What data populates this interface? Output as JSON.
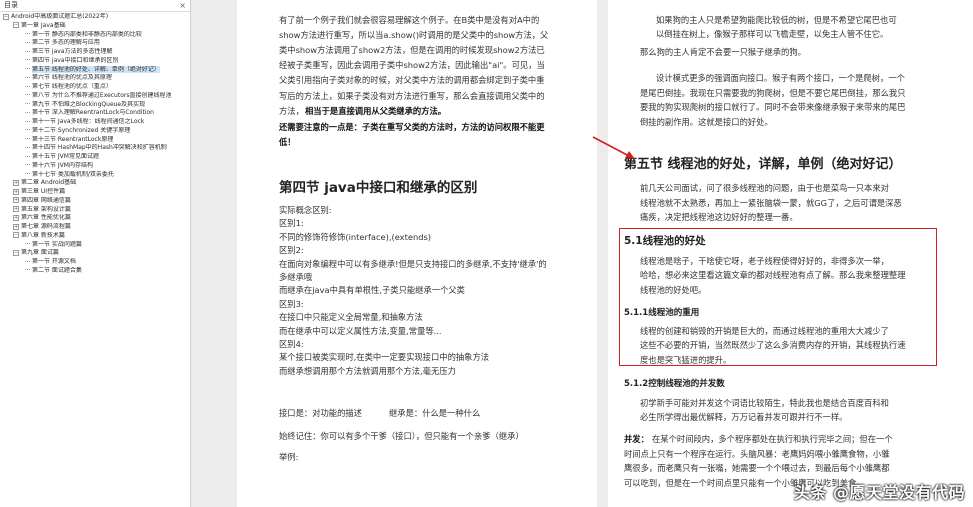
{
  "sidebar": {
    "title": "目录",
    "close_glyph": "×",
    "items": [
      {
        "lv": 0,
        "exp": "−",
        "label": "Android中高级面试题汇总(2022年)"
      },
      {
        "lv": 1,
        "exp": "−",
        "label": "第一章 Java基础"
      },
      {
        "lv": 2,
        "exp": "",
        "label": "第一节 静态内部类和非静态内部类的比较"
      },
      {
        "lv": 2,
        "exp": "",
        "label": "第二节 多态的理解与应用"
      },
      {
        "lv": 2,
        "exp": "",
        "label": "第三节 java方法的多态性理解"
      },
      {
        "lv": 2,
        "exp": "",
        "label": "第四节 java中接口和继承的区别"
      },
      {
        "lv": 2,
        "exp": "",
        "label": "第五节 线程池的好处、详解、单例（绝对好记）",
        "sel": true
      },
      {
        "lv": 2,
        "exp": "",
        "label": "第六节 线程池的优点及其原理"
      },
      {
        "lv": 2,
        "exp": "",
        "label": "第七节 线程池的优点（重点）"
      },
      {
        "lv": 2,
        "exp": "",
        "label": "第八节 为什么不推荐通过Executors直接创建线程池"
      },
      {
        "lv": 2,
        "exp": "",
        "label": "第九节 不怕难之BlockingQueue及其实现"
      },
      {
        "lv": 2,
        "exp": "",
        "label": "第十节 深入理解ReentrantLock与Condition"
      },
      {
        "lv": 2,
        "exp": "",
        "label": "第十一节 Java多线程：线程间通信之Lock"
      },
      {
        "lv": 2,
        "exp": "",
        "label": "第十二节 Synchronized 关键字原理"
      },
      {
        "lv": 2,
        "exp": "",
        "label": "第十三节 ReentrantLock原理"
      },
      {
        "lv": 2,
        "exp": "",
        "label": "第十四节 HashMap中的Hash冲突解决和扩容机制"
      },
      {
        "lv": 2,
        "exp": "",
        "label": "第十五节 JVM常见面试题"
      },
      {
        "lv": 2,
        "exp": "",
        "label": "第十六节 JVM内存结构"
      },
      {
        "lv": 2,
        "exp": "",
        "label": "第十七节 类加载机制/双亲委托"
      },
      {
        "lv": 1,
        "exp": "+",
        "label": "第二章 Android基础"
      },
      {
        "lv": 1,
        "exp": "+",
        "label": "第三章 UI控件篇"
      },
      {
        "lv": 1,
        "exp": "+",
        "label": "第四章 网络通信篇"
      },
      {
        "lv": 1,
        "exp": "+",
        "label": "第五章 架构设计篇"
      },
      {
        "lv": 1,
        "exp": "+",
        "label": "第六章 性能优化篇"
      },
      {
        "lv": 1,
        "exp": "+",
        "label": "第七章 源码流程篇"
      },
      {
        "lv": 1,
        "exp": "−",
        "label": "第八章 新技术篇"
      },
      {
        "lv": 2,
        "exp": "",
        "label": "第一节 实战问题篇"
      },
      {
        "lv": 1,
        "exp": "−",
        "label": "第九章 面试篇"
      },
      {
        "lv": 2,
        "exp": "",
        "label": "第一节 开源文档"
      },
      {
        "lv": 2,
        "exp": "",
        "label": "第二节 面试题合集"
      }
    ]
  },
  "page_left": {
    "intro_lines": [
      "有了前一个例子我们就会很容易理解这个例子。在B类中是没有对A中的",
      "show方法进行重写，所以当a.show()时调用的是父类中的show方法，父",
      "类中show方法调用了show2方法，但是在调用的时候发现show2方法已",
      "经被子类重写，因此会调用子类中show2方法，因此输出\"ai\"。可见，当",
      "父类引用指向子类对象的时候，对父类中方法的调用都会绑定到子类中重",
      "写后的方法上，如果子类没有对方法进行重写，那么会直接调用父类中的"
    ],
    "intro_tail": "方法，",
    "intro_bold": "相当于是直接调用从父类继承的方法。",
    "note_lines": [
      "还需要注意的一点是：子类在重写父类的方法时，方法的访问权限不能更",
      "低！"
    ],
    "section_title": "第四节 java中接口和继承的区别",
    "diff_lines": [
      "实际概念区别:",
      "区别1:",
      "不同的修饰符修饰(interface),(extends)",
      "区别2:",
      "在面向对象编程中可以有多继承!但是只支持接口的多继承,不支持'继承'的",
      "多继承哦",
      "而继承在java中具有单根性,子类只能继承一个父类",
      "区别3:",
      "在接口中只能定义全局常量,和抽象方法",
      "而在继承中可以定义属性方法,变量,常量等...",
      "区别4:",
      "某个接口被类实现时,在类中一定要实现接口中的抽象方法",
      "而继承想调用那个方法就调用那个方法,毫无压力"
    ],
    "summary_a": "接口是：对功能的描述",
    "summary_b": "继承是：什么是一种什么",
    "summary_c": "始终记住：你可以有多个干爹（接口），但只能有一个亲爹（继承）",
    "example_label": "举例:"
  },
  "page_right": {
    "top_lines": [
      "如果狗的主人只是希望狗能爬比较低的树，但是不希望它尾巴也可",
      "以倒挂在树上，像猴子那样可以飞檐走壁，以免主人管不住它。",
      "那么狗的主人肯定不会要一只猴子继承的狗。",
      "设计模式更多的强调面向接口。猴子有两个接口，一个是爬树，一个",
      "是尾巴倒挂。我现在只需要我的狗爬树，但是不要它尾巴倒挂，那么我只",
      "要我的狗实现爬树的接口就行了。同时不会带来像继承猴子来带来的尾巴",
      "倒挂的副作用。这就是接口的好处。"
    ],
    "section_title": "第五节 线程池的好处，详解，单例（绝对好记）",
    "section_intro": [
      "前几天公司面试，问了很多线程池的问题，由于也是菜鸟一只本来对",
      "线程池就不太熟悉，再加上一紧张脑袋一蒙，就GG了，之后可谓是深恶",
      "痛疾，决定把线程池这边好好的整理一番。"
    ],
    "h51": "5.1线程池的好处",
    "h51_lines": [
      "线程池是啥子，干啥使它呀，老子线程使得好好的，非得多次一举，",
      "哈哈，想必来这里看这篇文章的都对线程池有点了解。那么我来整理整理",
      "线程池的好处吧。"
    ],
    "h511": "5.1.1线程池的重用",
    "h511_lines": [
      "线程的创建和销毁的开销是巨大的，而通过线程池的重用大大减少了",
      "这些不必要的开销，当然既然少了这么多消费内存的开销，其线程执行速",
      "度也是突飞猛进的提升。"
    ],
    "h512": "5.1.2控制线程池的并发数",
    "h512_lines": [
      "初学新手可能对并发这个词语比较陌生，特此我也是结合百度百科和",
      "必生所学得出最优解释，万万记着并发可跟并行不一样。"
    ],
    "concurrency_term": "并发：",
    "concurrency_lines": [
      "在某个时间段内，多个程序都处在执行和执行完毕之间；但在一个",
      "时间点上只有一个程序在运行。头脑风暴：老鹰妈妈喂小雏鹰食物，小雏",
      "鹰很多，而老鹰只有一张嘴，她需要一个个喂过去，到最后每个小雏鹰都",
      "可以吃到，但是在一个时间点里只能有一个小雏鹰可以吃到美食。"
    ]
  },
  "watermark": "头条 @愿天堂没有代码",
  "colors": {
    "highlight": "#d02020",
    "selection": "#cde4f7"
  }
}
